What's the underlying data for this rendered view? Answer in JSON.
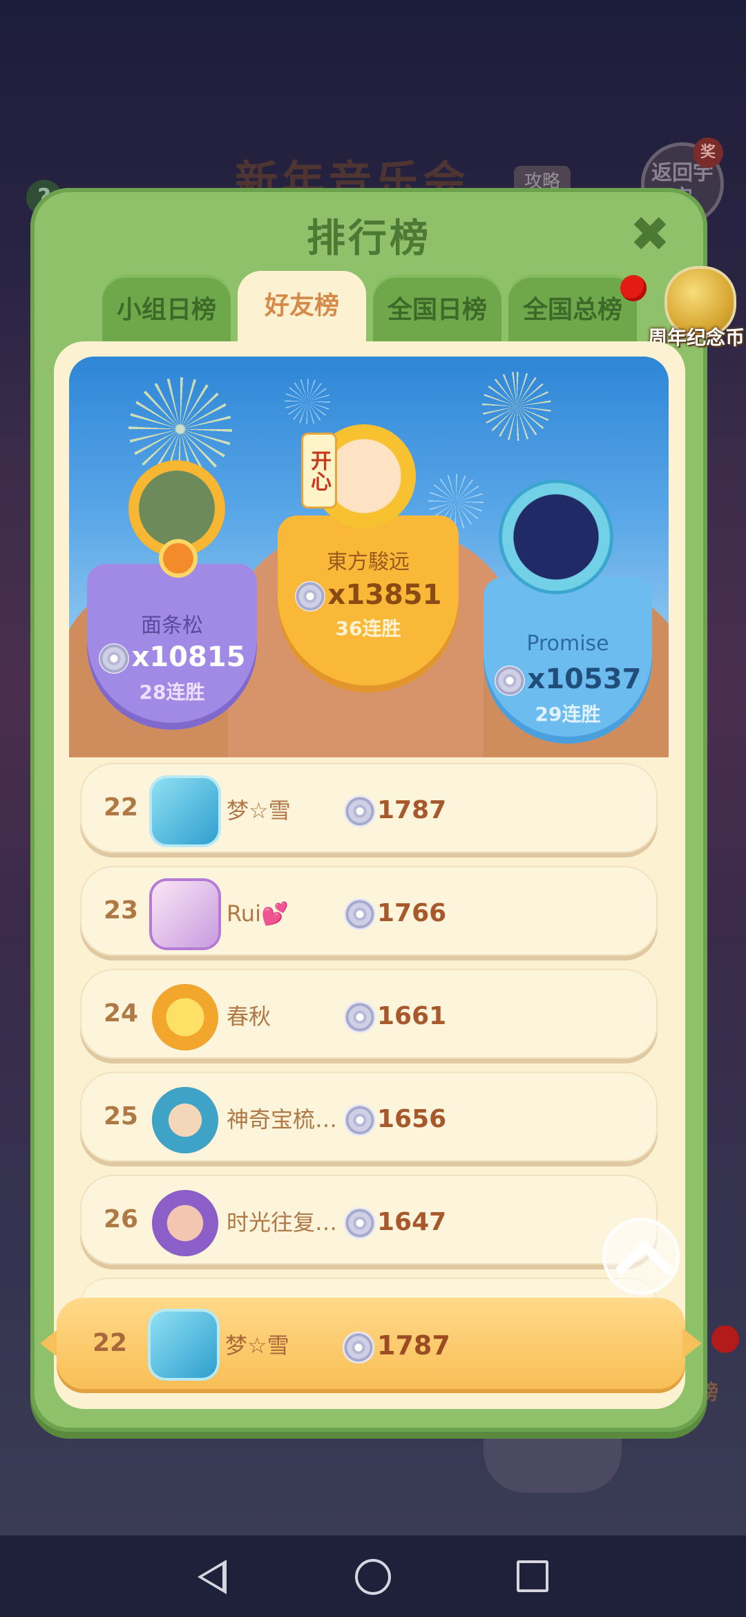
{
  "background": {
    "event_title": "新年音乐会",
    "guide_tag": "攻略",
    "return_button": "返回宇宙",
    "reward_dot": "奖",
    "side_label": "排行榜"
  },
  "dialog": {
    "title": "排行榜",
    "tabs": [
      {
        "label": "小组日榜",
        "active": false
      },
      {
        "label": "好友榜",
        "active": true
      },
      {
        "label": "全国日榜",
        "active": false
      },
      {
        "label": "全国总榜",
        "active": false,
        "has_notification": true
      }
    ],
    "anniversary_coin_label": "周年纪念币"
  },
  "podium": [
    {
      "place": 2,
      "name": "面条松",
      "score": "x10815",
      "wins": "28连胜",
      "color": "#9c86e0"
    },
    {
      "place": 1,
      "name": "東方駿远",
      "score": "x13851",
      "wins": "36连胜",
      "color": "#f6b83b",
      "badge": "开心"
    },
    {
      "place": 3,
      "name": "Promise",
      "score": "x10537",
      "wins": "29连胜",
      "color": "#69b7ec"
    }
  ],
  "rows": [
    {
      "rank": "22",
      "name": "梦☆雪",
      "score": "1787",
      "avatar_color": "#5fc6e6"
    },
    {
      "rank": "23",
      "name": "Rui💕",
      "score": "1766",
      "avatar_color": "#c99ae0"
    },
    {
      "rank": "24",
      "name": "春秋",
      "score": "1661",
      "avatar_color": "#f1b23e"
    },
    {
      "rank": "25",
      "name": "神奇宝梳…",
      "score": "1656",
      "avatar_color": "#3fa3c8"
    },
    {
      "rank": "26",
      "name": "时光往复…",
      "score": "1647",
      "avatar_color": "#8b5fc7"
    }
  ],
  "my_rank": {
    "rank": "22",
    "name": "梦☆雪",
    "score": "1787",
    "avatar_color": "#5fc6e6"
  },
  "colors": {
    "dialog_green": "#8fc16a",
    "tab_active_text": "#d68a4a",
    "rank_text": "#b07844",
    "my_bar": "#f8bf55"
  },
  "icons": {
    "close": "close-icon",
    "disc": "record-disc-icon",
    "scroll_top": "chevron-up-icon"
  }
}
